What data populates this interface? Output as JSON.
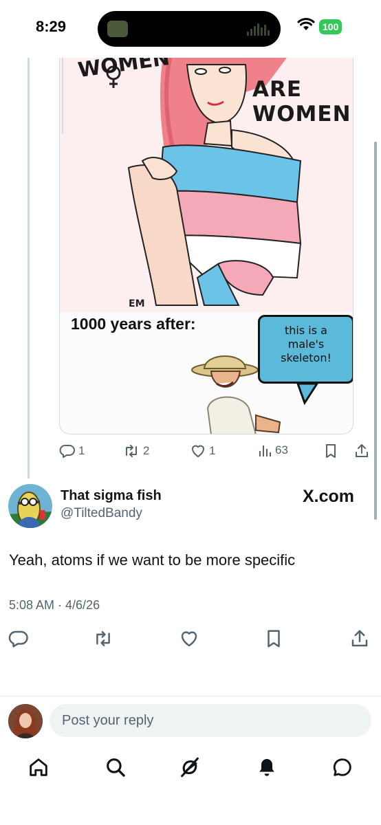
{
  "status_bar": {
    "time": "8:29",
    "battery": "100"
  },
  "meme": {
    "top_word": "WOMEN",
    "are_women_line1": "ARE",
    "are_women_line2": "WOMEN",
    "signature": "EM",
    "caption": "1000 years after:",
    "speech_bubble": "this is a male's skeleton!"
  },
  "quoted_post_actions": {
    "replies": "1",
    "reposts": "2",
    "likes": "1",
    "views": "63"
  },
  "reply_post": {
    "author_name": "That sigma fish",
    "author_handle": "@TiltedBandy",
    "watermark": "X.com",
    "text": "Yeah, atoms if we want to be more specific",
    "timestamp": "5:08 AM · 4/6/26"
  },
  "composer": {
    "placeholder": "Post your reply"
  },
  "colors": {
    "accent_blue": "#1d9bf0",
    "text_primary": "#0f1419",
    "text_secondary": "#536471",
    "battery_green": "#34c759"
  },
  "icons": {
    "reply": "reply-icon",
    "repost": "repost-icon",
    "like": "heart-icon",
    "views": "views-icon",
    "bookmark": "bookmark-icon",
    "share": "share-icon",
    "home": "home-icon",
    "search": "search-icon",
    "grok": "grok-icon",
    "notifications": "bell-icon",
    "messages": "message-icon"
  }
}
